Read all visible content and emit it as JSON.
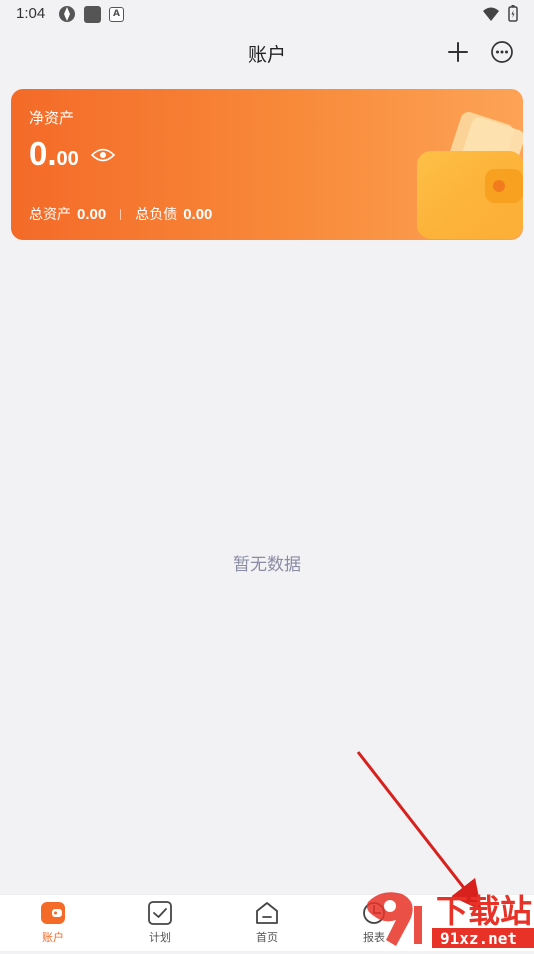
{
  "status": {
    "time": "1:04",
    "a_icon": "A"
  },
  "header": {
    "title": "账户"
  },
  "card": {
    "net_label": "净资产",
    "net_int": "0.",
    "net_dec": "00",
    "total_assets_label": "总资产",
    "total_assets_value": "0.00",
    "total_liab_label": "总负债",
    "total_liab_value": "0.00"
  },
  "empty": {
    "text": "暂无数据"
  },
  "tabs": [
    {
      "label": "账户",
      "icon": "wallet-icon"
    },
    {
      "label": "计划",
      "icon": "checkbox-icon"
    },
    {
      "label": "首页",
      "icon": "home-icon"
    },
    {
      "label": "报表",
      "icon": "report-icon"
    }
  ],
  "watermark": {
    "line1": "下载站",
    "line2": "91xz.net"
  },
  "colors": {
    "accent": "#f46a28",
    "empty_text": "#8a8ca3"
  }
}
